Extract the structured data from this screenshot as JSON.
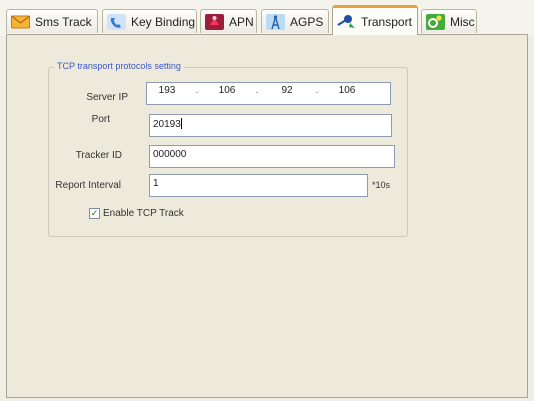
{
  "tabs": [
    {
      "label": "Sms Track",
      "icon": "envelope-icon"
    },
    {
      "label": "Key Binding",
      "icon": "phone-icon"
    },
    {
      "label": "APN",
      "icon": "antenna-icon"
    },
    {
      "label": "AGPS",
      "icon": "tower-icon"
    },
    {
      "label": "Transport",
      "icon": "satellite-icon",
      "active": true
    },
    {
      "label": "Misc",
      "icon": "gears-icon"
    }
  ],
  "group": {
    "legend": "TCP transport protocols setting",
    "server_ip": {
      "label": "Server IP",
      "octets": [
        "193",
        "106",
        "92",
        "106"
      ],
      "separator": "."
    },
    "port": {
      "label": "Port",
      "value": "20193"
    },
    "tracker_id": {
      "label": "Tracker ID",
      "value": "000000"
    },
    "report_interval": {
      "label": "Report Interval",
      "value": "1",
      "unit": "*10s"
    },
    "enable_tcp": {
      "label": "Enable TCP Track",
      "checked": true
    }
  },
  "colors": {
    "accent": "#e7a23b",
    "legend": "#3b58c6",
    "panel": "#edeadb"
  }
}
